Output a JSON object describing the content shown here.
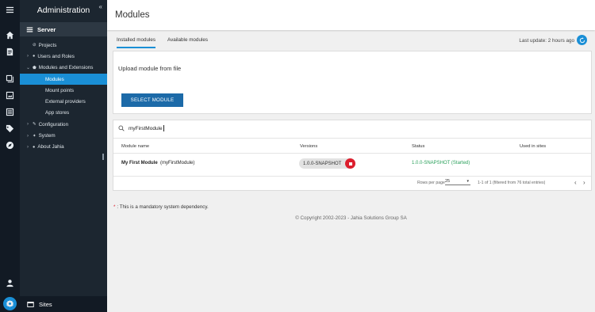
{
  "sidebar": {
    "title": "Administration",
    "collapse_glyph": "«",
    "section": "Server",
    "items": [
      {
        "label": "Projects",
        "glyph": "⊘",
        "caret": ""
      },
      {
        "label": "Users and Roles",
        "glyph": "👥",
        "caret": "›"
      },
      {
        "label": "Modules and Extensions",
        "glyph": "⬟",
        "caret": "⌄"
      },
      {
        "label": "Modules",
        "glyph": "",
        "caret": ""
      },
      {
        "label": "Mount points",
        "glyph": "",
        "caret": ""
      },
      {
        "label": "External providers",
        "glyph": "",
        "caret": ""
      },
      {
        "label": "App stores",
        "glyph": "",
        "caret": ""
      },
      {
        "label": "Configuration",
        "glyph": "✎",
        "caret": "›"
      },
      {
        "label": "System",
        "glyph": "✦",
        "caret": "›"
      },
      {
        "label": "About Jahia",
        "glyph": "●",
        "caret": "›"
      }
    ],
    "sites_label": "Sites"
  },
  "rail_icons": [
    "menu-icon",
    "home-icon",
    "document-icon",
    "media-icon",
    "gallery-icon",
    "list-icon",
    "tag-icon",
    "compass-icon",
    "user-icon",
    "settings-icon"
  ],
  "page": {
    "title": "Modules",
    "tabs": [
      "Installed modules",
      "Available modules"
    ],
    "last_update": "Last update: 2 hours ago"
  },
  "upload": {
    "label": "Upload module from file",
    "button": "SELECT MODULE"
  },
  "search": {
    "value": "myFirstModule"
  },
  "table": {
    "headers": [
      "Module name",
      "Versions",
      "Status",
      "Used in sites"
    ],
    "rows": [
      {
        "name": "My First Module",
        "id": "(myFirstModule)",
        "version": "1.0.0-SNAPSHOT",
        "status": "1.0.0-SNAPSHOT (Started)",
        "sites": ""
      }
    ]
  },
  "pagination": {
    "rows_per_page_label": "Rows per page",
    "rows_per_page": "25",
    "range": "1-1 of 1 (filtered from 76 total entries)",
    "prev": "‹",
    "next": "›"
  },
  "footer": {
    "note_star": "*",
    "note": ": This is a mandatory system dependency.",
    "copyright": "© Copyright 2002-2023 - Jahia Solutions Group SA"
  },
  "colors": {
    "accent": "#1a8fd6",
    "sidebar_bg": "#1c2630",
    "rail_bg": "#121a24",
    "button_bg": "#1c6aa8",
    "status_green": "#2aa05b",
    "stop_red": "#dc1f2e"
  }
}
